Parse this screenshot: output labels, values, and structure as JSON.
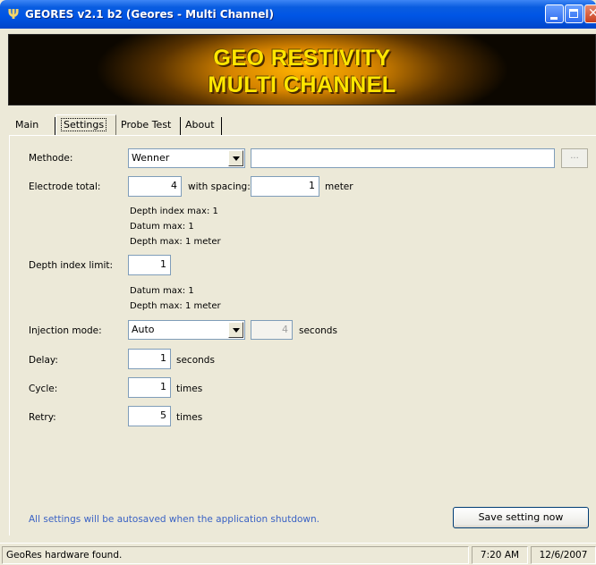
{
  "window": {
    "title": "GEORES v2.1 b2 (Geores - Multi Channel)",
    "icon": "tuning-fork-icon",
    "caption_buttons": [
      "minimize",
      "maximize",
      "close"
    ]
  },
  "banner": {
    "line1": "GEO RESTIVITY",
    "line2": "MULTI CHANNEL"
  },
  "tabs": [
    {
      "label": "Main",
      "active": false
    },
    {
      "label": "Settings",
      "active": true
    },
    {
      "label": "Probe Test",
      "active": false
    },
    {
      "label": "About",
      "active": false
    }
  ],
  "settings": {
    "methode": {
      "label": "Methode:",
      "selected": "Wenner",
      "path_value": "",
      "browse_label": "..."
    },
    "electrode": {
      "label": "Electrode total:",
      "total": "4",
      "spacing_label": "with spacing:",
      "spacing": "1",
      "unit": "meter"
    },
    "electrode_info": [
      "Depth index max: 1",
      "Datum max: 1",
      "Depth max: 1 meter"
    ],
    "depth_index": {
      "label": "Depth index limit:",
      "value": "1"
    },
    "depth_info": [
      "Datum max: 1",
      "Depth max: 1 meter"
    ],
    "injection": {
      "label": "Injection mode:",
      "selected": "Auto",
      "seconds": "4",
      "unit": "seconds"
    },
    "delay": {
      "label": "Delay:",
      "value": "1",
      "unit": "seconds"
    },
    "cycle": {
      "label": "Cycle:",
      "value": "1",
      "unit": "times"
    },
    "retry": {
      "label": "Retry:",
      "value": "5",
      "unit": "times"
    },
    "autosave_note": "All settings will be autosaved when the application shutdown.",
    "save_button": "Save setting now"
  },
  "statusbar": {
    "message": "GeoRes hardware found.",
    "time": "7:20 AM",
    "date": "12/6/2007"
  },
  "colors": {
    "titlebar": "#0055e5",
    "banner_text": "#ffe600",
    "note_text": "#3a62c4"
  }
}
